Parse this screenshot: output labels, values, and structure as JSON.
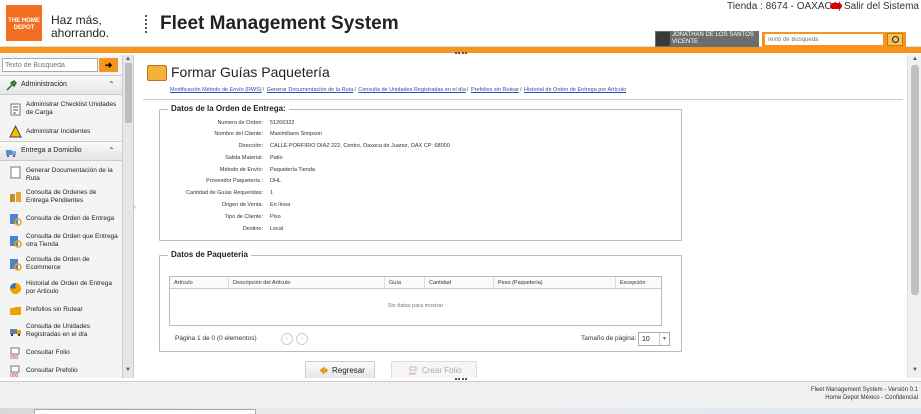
{
  "header": {
    "logo_text": "THE HOME DEPOT",
    "slogan_line1": "Haz más,",
    "slogan_line2": "ahorrando.",
    "app_title": "Fleet Management System",
    "store_info": "Tienda : 8674 - OAXACA|",
    "logout_label": "Salir del Sistema",
    "user_name_line1": "JONATHAN DE LOS SANTOS",
    "user_name_line2": "VICENTE",
    "search_placeholder": "Texto de Busqueda"
  },
  "sidebar": {
    "search_placeholder": "Texto de Busqueda",
    "search_button": "➜",
    "groups": [
      {
        "label": "Administración",
        "items": [
          {
            "label": "Administrar Checklist Unidades de Carga",
            "icon": "checklist-icon"
          },
          {
            "label": "Administrar Incidentes",
            "icon": "warning-icon"
          }
        ]
      },
      {
        "label": "Entrega a Domicilio",
        "items": [
          {
            "label": "Generar Documentación de la Ruta",
            "icon": "document-icon"
          },
          {
            "label": "Consulta de Ordenes de Entrega Pendientes",
            "icon": "orders-icon"
          },
          {
            "label": "Consulta de Orden de Entrega",
            "icon": "search-order-icon"
          },
          {
            "label": "Consulta de Orden que Entrega otra Tienda",
            "icon": "search-order-icon"
          },
          {
            "label": "Consulta de Orden de Ecommerce",
            "icon": "search-order-icon"
          },
          {
            "label": "Historial de Orden de Entrega por Articulo",
            "icon": "history-icon"
          },
          {
            "label": "Prefolios sin Rutear",
            "icon": "folder-icon"
          },
          {
            "label": "Consulta de Unidades Registradas en el día",
            "icon": "truck-icon"
          },
          {
            "label": "Consultar Folio",
            "icon": "folio-icon"
          },
          {
            "label": "Consultar Prefolio",
            "icon": "folio-icon"
          }
        ]
      }
    ]
  },
  "page": {
    "title": "Formar Guías Paquetería",
    "breadcrumbs": [
      "Modificación Método de Envío (RWS)",
      "Generar Documentación de la Ruta",
      "Consulta de Unidades Registradas en el día",
      "Prefolios sin Rutear",
      "Historial de Orden de Entrega por Artículo"
    ]
  },
  "order": {
    "legend": "Datos de la Orden de Entrega:",
    "fields": [
      {
        "label": "Numero de Orden:",
        "value": "51266322"
      },
      {
        "label": "Nombre del Cliente:",
        "value": "Maximiliano Simpson"
      },
      {
        "label": "Dirección:",
        "value": "CALLE PORFIRIO DIAZ 222, Centro, Oaxaca de Juarez, OAX CP: 68000"
      },
      {
        "label": "Salida Material:",
        "value": "Patio"
      },
      {
        "label": "Método de Envío:",
        "value": "Paquetería Tienda"
      },
      {
        "label": "Proveedor Paquetería :",
        "value": "DHL"
      },
      {
        "label": "Cantidad de Guías Requeridas:",
        "value": "1"
      },
      {
        "label": "Origen de Venta:",
        "value": "En línea"
      },
      {
        "label": "Tipo de Cliente:",
        "value": "Piso"
      },
      {
        "label": "Destino:",
        "value": "Local"
      }
    ]
  },
  "package": {
    "legend": "Datos de Paqueteria",
    "columns": [
      "Artículo",
      "Descripción del Artículo",
      "Guía",
      "Cantidad",
      "Peso (Paquetería)",
      "Excepción"
    ],
    "empty_message": "Sin datos para mostrar",
    "pager_text": "Página 1 de 0 (0 elementos)",
    "page_size_label": "Tamaño de página:",
    "page_size_value": "10"
  },
  "actions": {
    "back_label": "Regresar",
    "create_label": "Crear Folio"
  },
  "footer": {
    "line1": "Fleet Management System - Versión 0.1",
    "line2": "Home Depot México - Confidencial"
  },
  "colors": {
    "brand_orange": "#f26f21",
    "accent_orange": "#f7941d",
    "link_blue": "#2850a8"
  }
}
